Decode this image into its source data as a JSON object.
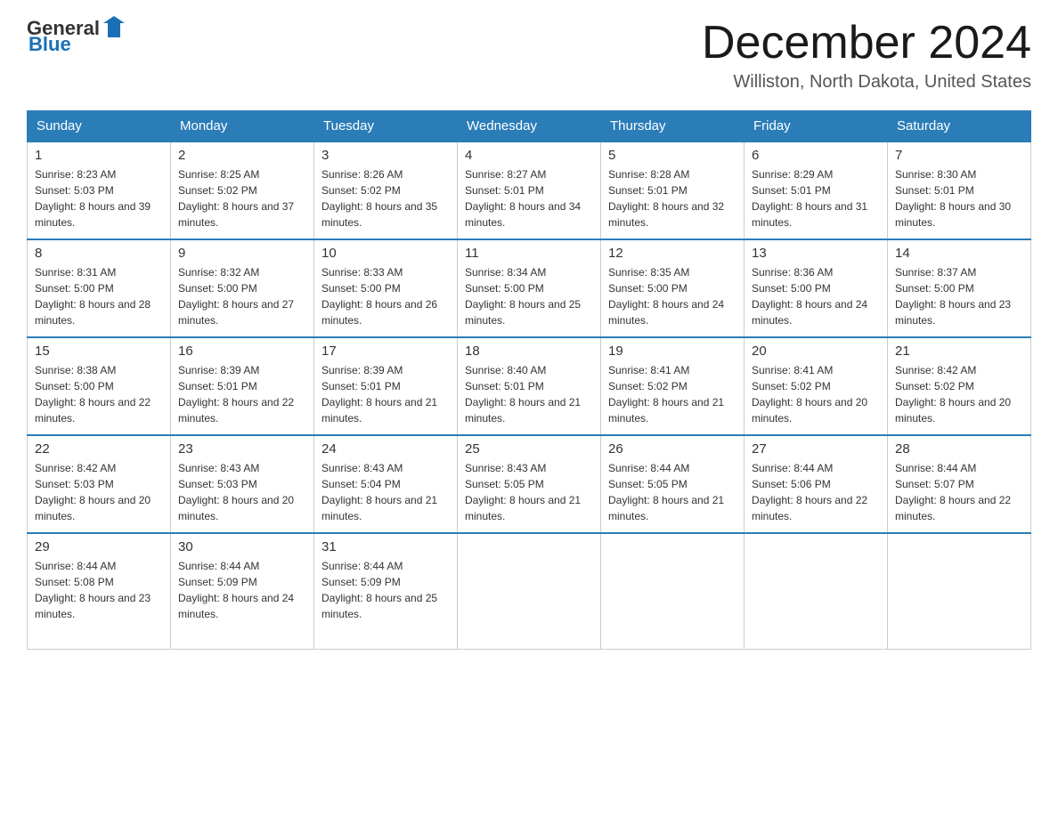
{
  "header": {
    "logo": {
      "general": "General",
      "blue": "Blue"
    },
    "title": "December 2024",
    "location": "Williston, North Dakota, United States"
  },
  "weekdays": [
    "Sunday",
    "Monday",
    "Tuesday",
    "Wednesday",
    "Thursday",
    "Friday",
    "Saturday"
  ],
  "weeks": [
    [
      {
        "day": "1",
        "sunrise": "8:23 AM",
        "sunset": "5:03 PM",
        "daylight": "8 hours and 39 minutes."
      },
      {
        "day": "2",
        "sunrise": "8:25 AM",
        "sunset": "5:02 PM",
        "daylight": "8 hours and 37 minutes."
      },
      {
        "day": "3",
        "sunrise": "8:26 AM",
        "sunset": "5:02 PM",
        "daylight": "8 hours and 35 minutes."
      },
      {
        "day": "4",
        "sunrise": "8:27 AM",
        "sunset": "5:01 PM",
        "daylight": "8 hours and 34 minutes."
      },
      {
        "day": "5",
        "sunrise": "8:28 AM",
        "sunset": "5:01 PM",
        "daylight": "8 hours and 32 minutes."
      },
      {
        "day": "6",
        "sunrise": "8:29 AM",
        "sunset": "5:01 PM",
        "daylight": "8 hours and 31 minutes."
      },
      {
        "day": "7",
        "sunrise": "8:30 AM",
        "sunset": "5:01 PM",
        "daylight": "8 hours and 30 minutes."
      }
    ],
    [
      {
        "day": "8",
        "sunrise": "8:31 AM",
        "sunset": "5:00 PM",
        "daylight": "8 hours and 28 minutes."
      },
      {
        "day": "9",
        "sunrise": "8:32 AM",
        "sunset": "5:00 PM",
        "daylight": "8 hours and 27 minutes."
      },
      {
        "day": "10",
        "sunrise": "8:33 AM",
        "sunset": "5:00 PM",
        "daylight": "8 hours and 26 minutes."
      },
      {
        "day": "11",
        "sunrise": "8:34 AM",
        "sunset": "5:00 PM",
        "daylight": "8 hours and 25 minutes."
      },
      {
        "day": "12",
        "sunrise": "8:35 AM",
        "sunset": "5:00 PM",
        "daylight": "8 hours and 24 minutes."
      },
      {
        "day": "13",
        "sunrise": "8:36 AM",
        "sunset": "5:00 PM",
        "daylight": "8 hours and 24 minutes."
      },
      {
        "day": "14",
        "sunrise": "8:37 AM",
        "sunset": "5:00 PM",
        "daylight": "8 hours and 23 minutes."
      }
    ],
    [
      {
        "day": "15",
        "sunrise": "8:38 AM",
        "sunset": "5:00 PM",
        "daylight": "8 hours and 22 minutes."
      },
      {
        "day": "16",
        "sunrise": "8:39 AM",
        "sunset": "5:01 PM",
        "daylight": "8 hours and 22 minutes."
      },
      {
        "day": "17",
        "sunrise": "8:39 AM",
        "sunset": "5:01 PM",
        "daylight": "8 hours and 21 minutes."
      },
      {
        "day": "18",
        "sunrise": "8:40 AM",
        "sunset": "5:01 PM",
        "daylight": "8 hours and 21 minutes."
      },
      {
        "day": "19",
        "sunrise": "8:41 AM",
        "sunset": "5:02 PM",
        "daylight": "8 hours and 21 minutes."
      },
      {
        "day": "20",
        "sunrise": "8:41 AM",
        "sunset": "5:02 PM",
        "daylight": "8 hours and 20 minutes."
      },
      {
        "day": "21",
        "sunrise": "8:42 AM",
        "sunset": "5:02 PM",
        "daylight": "8 hours and 20 minutes."
      }
    ],
    [
      {
        "day": "22",
        "sunrise": "8:42 AM",
        "sunset": "5:03 PM",
        "daylight": "8 hours and 20 minutes."
      },
      {
        "day": "23",
        "sunrise": "8:43 AM",
        "sunset": "5:03 PM",
        "daylight": "8 hours and 20 minutes."
      },
      {
        "day": "24",
        "sunrise": "8:43 AM",
        "sunset": "5:04 PM",
        "daylight": "8 hours and 21 minutes."
      },
      {
        "day": "25",
        "sunrise": "8:43 AM",
        "sunset": "5:05 PM",
        "daylight": "8 hours and 21 minutes."
      },
      {
        "day": "26",
        "sunrise": "8:44 AM",
        "sunset": "5:05 PM",
        "daylight": "8 hours and 21 minutes."
      },
      {
        "day": "27",
        "sunrise": "8:44 AM",
        "sunset": "5:06 PM",
        "daylight": "8 hours and 22 minutes."
      },
      {
        "day": "28",
        "sunrise": "8:44 AM",
        "sunset": "5:07 PM",
        "daylight": "8 hours and 22 minutes."
      }
    ],
    [
      {
        "day": "29",
        "sunrise": "8:44 AM",
        "sunset": "5:08 PM",
        "daylight": "8 hours and 23 minutes."
      },
      {
        "day": "30",
        "sunrise": "8:44 AM",
        "sunset": "5:09 PM",
        "daylight": "8 hours and 24 minutes."
      },
      {
        "day": "31",
        "sunrise": "8:44 AM",
        "sunset": "5:09 PM",
        "daylight": "8 hours and 25 minutes."
      },
      null,
      null,
      null,
      null
    ]
  ]
}
